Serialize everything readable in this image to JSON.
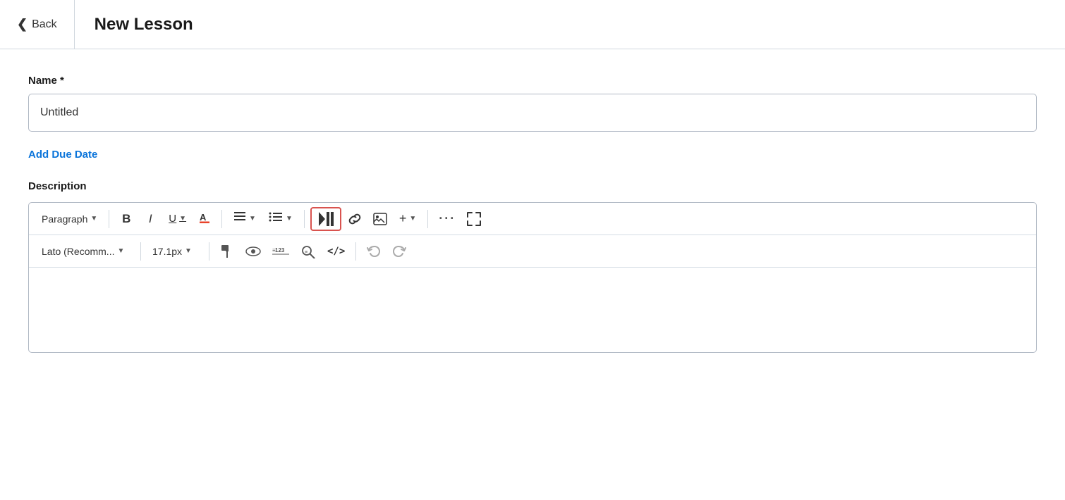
{
  "header": {
    "back_label": "Back",
    "title": "New Lesson"
  },
  "form": {
    "name_label": "Name *",
    "name_value": "Untitled",
    "add_due_date_label": "Add Due Date",
    "description_label": "Description"
  },
  "toolbar_row1": {
    "paragraph_label": "Paragraph",
    "bold_label": "B",
    "italic_label": "I",
    "underline_label": "U",
    "text_color_label": "A",
    "align_label": "≡",
    "list_label": "☰",
    "media_label": "▶||",
    "link_label": "🔗",
    "image_label": "🖼",
    "add_label": "+",
    "more_label": "···",
    "fullscreen_label": "⤢"
  },
  "toolbar_row2": {
    "font_label": "Lato (Recomm...",
    "size_label": "17.1px",
    "format_painter_label": "🖌",
    "highlight_label": "👁",
    "numbered_list_label": "≡123",
    "find_replace_label": "🔍",
    "code_label": "</>",
    "undo_label": "↩",
    "redo_label": "↪"
  },
  "colors": {
    "active_red": "#d9534f",
    "link_blue": "#0a74da"
  }
}
